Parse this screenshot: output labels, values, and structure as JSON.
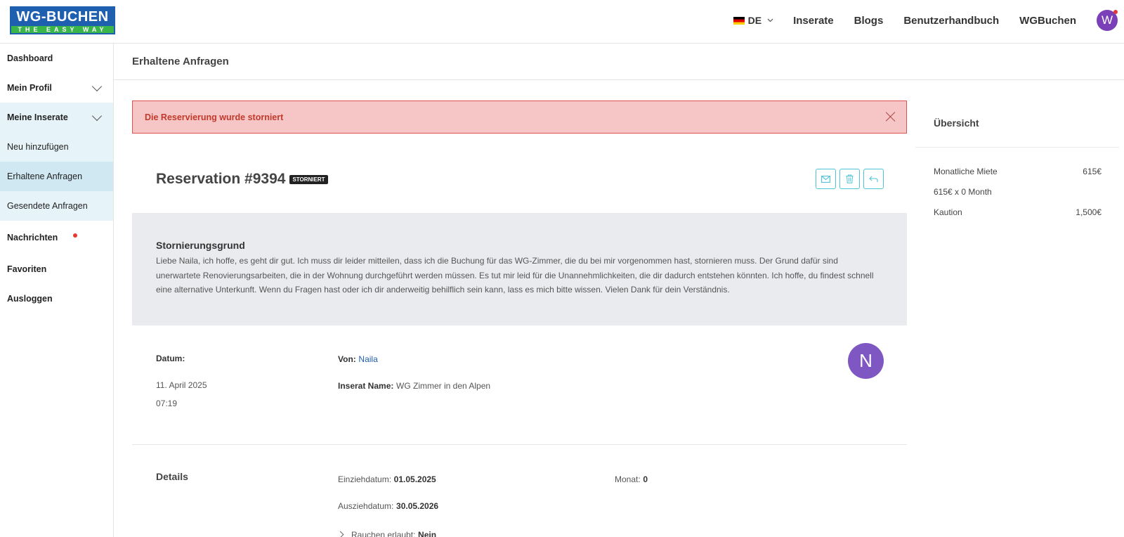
{
  "header": {
    "logo_top": "WG-BUCHEN",
    "logo_bottom": "THE EASY WAY",
    "language": "DE",
    "nav": [
      "Inserate",
      "Blogs",
      "Benutzerhandbuch",
      "WGBuchen"
    ],
    "avatar_initial": "W"
  },
  "sidebar": {
    "items": [
      {
        "label": "Dashboard"
      },
      {
        "label": "Mein Profil"
      },
      {
        "label": "Meine Inserate"
      },
      {
        "label": "Neu hinzufügen"
      },
      {
        "label": "Erhaltene Anfragen"
      },
      {
        "label": "Gesendete Anfragen"
      },
      {
        "label": "Nachrichten"
      },
      {
        "label": "Favoriten"
      },
      {
        "label": "Ausloggen"
      }
    ]
  },
  "page": {
    "title": "Erhaltene Anfragen",
    "alert": "Die Reservierung wurde storniert",
    "reservation_title": "Reservation #9394",
    "status_badge": "STORNIERT",
    "reason": {
      "title": "Stornierungsgrund",
      "text": "Liebe Naila, ich hoffe, es geht dir gut. Ich muss dir leider mitteilen, dass ich die Buchung für das WG-Zimmer, die du bei mir vorgenommen hast, stornieren muss. Der Grund dafür sind unerwartete Renovierungsarbeiten, die in der Wohnung durchgeführt werden müssen. Es tut mir leid für die Unannehmlichkeiten, die dir dadurch entstehen könnten. Ich hoffe, du findest schnell eine alternative Unterkunft. Wenn du Fragen hast oder ich dir anderweitig behilflich sein kann, lass es mich bitte wissen. Vielen Dank für dein Verständnis."
    },
    "datum_label": "Datum:",
    "date": "11. April 2025",
    "time": "07:19",
    "von_label": "Von:",
    "von_value": "Naila",
    "inserat_label": "Inserat Name:",
    "inserat_value": "WG Zimmer in den Alpen",
    "guest_initial": "N",
    "details": {
      "title": "Details",
      "einzug_label": "Einziehdatum:",
      "einzug_value": "01.05.2025",
      "monat_label": "Monat:",
      "monat_value": "0",
      "auszug_label": "Ausziehdatum:",
      "auszug_value": "30.05.2026",
      "rauchen_label": "Rauchen erlaubt:",
      "rauchen_value": "Nein"
    }
  },
  "overview": {
    "title": "Übersicht",
    "rows": [
      {
        "label": "Monatliche Miete",
        "value": "615€"
      },
      {
        "label": "615€ x 0 Month",
        "value": ""
      },
      {
        "label": "Kaution",
        "value": "1,500€"
      }
    ]
  },
  "colors": {
    "brand_blue": "#1f5fb0",
    "brand_green": "#39b54a",
    "alert_bg": "#f6c6c6",
    "alert_text": "#c0392b",
    "accent_cyan": "#4fc3d9",
    "avatar_purple": "#7e57c2"
  },
  "icons": [
    "chevron-down-icon",
    "close-icon",
    "mail-icon",
    "trash-icon",
    "reply-icon",
    "chevron-right-icon"
  ]
}
